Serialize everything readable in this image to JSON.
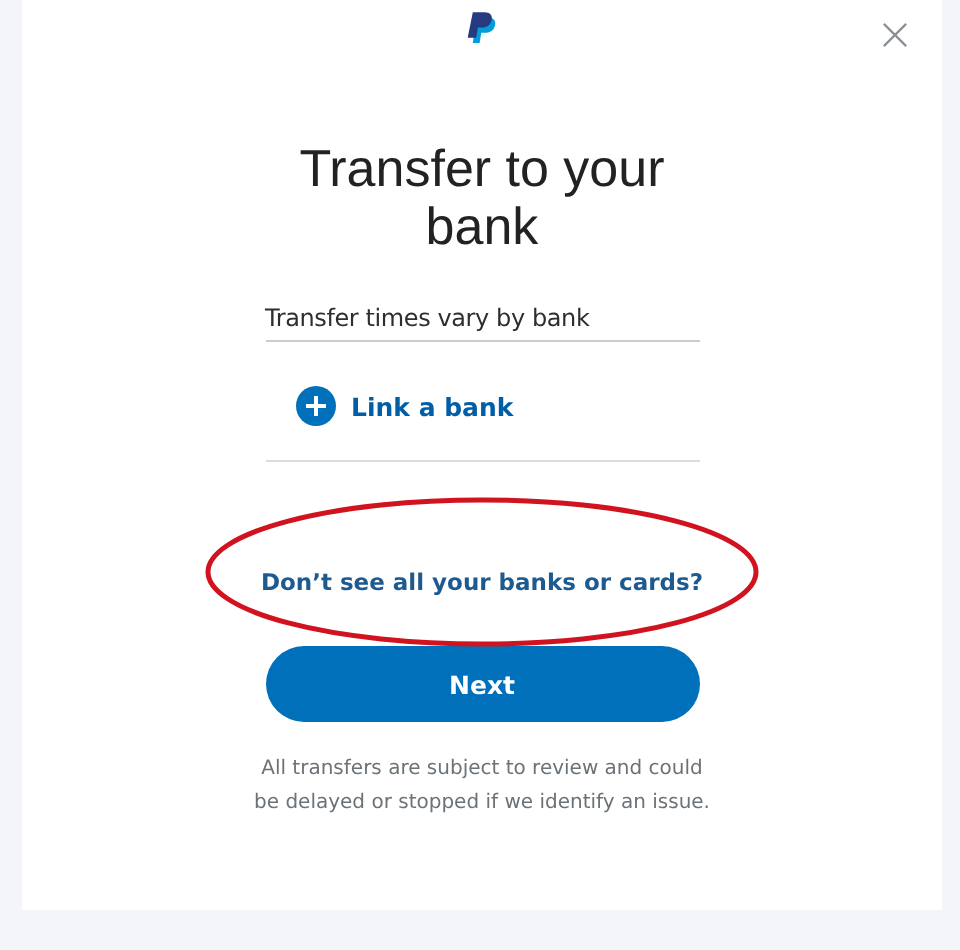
{
  "dialog": {
    "title": "Transfer to your bank",
    "subtitle": "Transfer times vary by bank",
    "link_bank": {
      "label": "Link a bank"
    },
    "help_link": "Don’t see all your banks or cards?",
    "next_button": "Next",
    "disclaimer": "All transfers are subject to review and could be delayed or stopped if we identify an issue."
  }
}
